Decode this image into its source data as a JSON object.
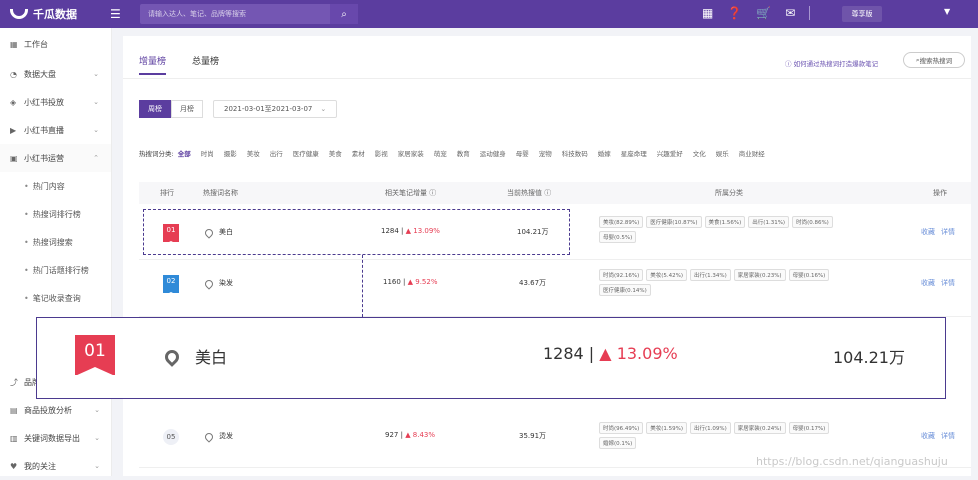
{
  "topbar": {
    "brand": "千瓜数据",
    "search_placeholder": "请输入达人、笔记、品牌等搜索",
    "plan_label": "尊享版"
  },
  "sidebar": {
    "items": [
      {
        "label": "工作台",
        "icon": "dashboard-icon",
        "chevron": false
      },
      {
        "label": "数据大盘",
        "icon": "chart-icon",
        "chevron": true
      },
      {
        "label": "小红书投放",
        "icon": "send-icon",
        "chevron": true
      },
      {
        "label": "小红书直播",
        "icon": "video-icon",
        "chevron": true
      },
      {
        "label": "小红书运营",
        "icon": "store-icon",
        "chevron": true
      }
    ],
    "sub_items": [
      {
        "label": "热门内容"
      },
      {
        "label": "热搜词排行榜"
      },
      {
        "label": "热搜词搜索"
      },
      {
        "label": "热门话题排行榜"
      },
      {
        "label": "笔记收录查询"
      }
    ],
    "bottom_items": [
      {
        "label": "品牌",
        "icon": "trend-icon"
      },
      {
        "label": "商品投放分析",
        "icon": "bag-icon"
      },
      {
        "label": "关键词数据导出",
        "icon": "export-icon"
      },
      {
        "label": "我的关注",
        "icon": "star-icon"
      }
    ]
  },
  "tabs": [
    "增量榜",
    "总量榜"
  ],
  "help_link": "如何通过热搜词打造爆款笔记",
  "search_words_button": "搜索热搜词",
  "period": {
    "week": "周榜",
    "month": "月榜",
    "date_range": "2021-03-01至2021-03-07"
  },
  "categories": {
    "label": "热搜词分类:",
    "items": [
      "全部",
      "时尚",
      "摄影",
      "美妆",
      "出行",
      "医疗健康",
      "美食",
      "素材",
      "影视",
      "家居家装",
      "萌宠",
      "教育",
      "运动健身",
      "母婴",
      "宠物",
      "科技数码",
      "婚嫁",
      "星座命理",
      "兴趣爱好",
      "文化",
      "娱乐",
      "商业财经"
    ]
  },
  "table": {
    "headers": {
      "rank": "排行",
      "word": "热搜词名称",
      "count": "相关笔记增量",
      "heat": "当前热搜值",
      "category": "所属分类",
      "ops": "操作"
    },
    "rows": [
      {
        "rank": "01",
        "word": "美白",
        "count": "1284 |",
        "pct": "13.09%",
        "heat": "104.21万",
        "chips": [
          "美妆(82.89%)",
          "医疗健康(10.87%)",
          "美食(1.56%)",
          "出行(1.31%)",
          "时尚(0.86%)",
          "母婴(0.5%)"
        ]
      },
      {
        "rank": "02",
        "word": "染发",
        "count": "1160 |",
        "pct": "9.52%",
        "heat": "43.67万",
        "chips": [
          "时尚(92.16%)",
          "美妆(5.42%)",
          "出行(1.34%)",
          "家居家装(0.23%)",
          "母婴(0.16%)",
          "医疗健康(0.14%)"
        ]
      },
      {
        "rank": "05",
        "word": "烫发",
        "count": "927 |",
        "pct": "8.43%",
        "heat": "35.91万",
        "chips": [
          "时尚(96.49%)",
          "美妆(1.59%)",
          "出行(1.09%)",
          "家居家装(0.24%)",
          "母婴(0.17%)",
          "婚嫁(0.1%)"
        ]
      }
    ],
    "op_collect": "收藏",
    "op_detail": "详情"
  },
  "zoom": {
    "rank": "01",
    "word": "美白",
    "count": "1284 |",
    "pct": "13.09%",
    "heat": "104.21万"
  },
  "watermark": "https://blog.csdn.net/qianguashuju"
}
